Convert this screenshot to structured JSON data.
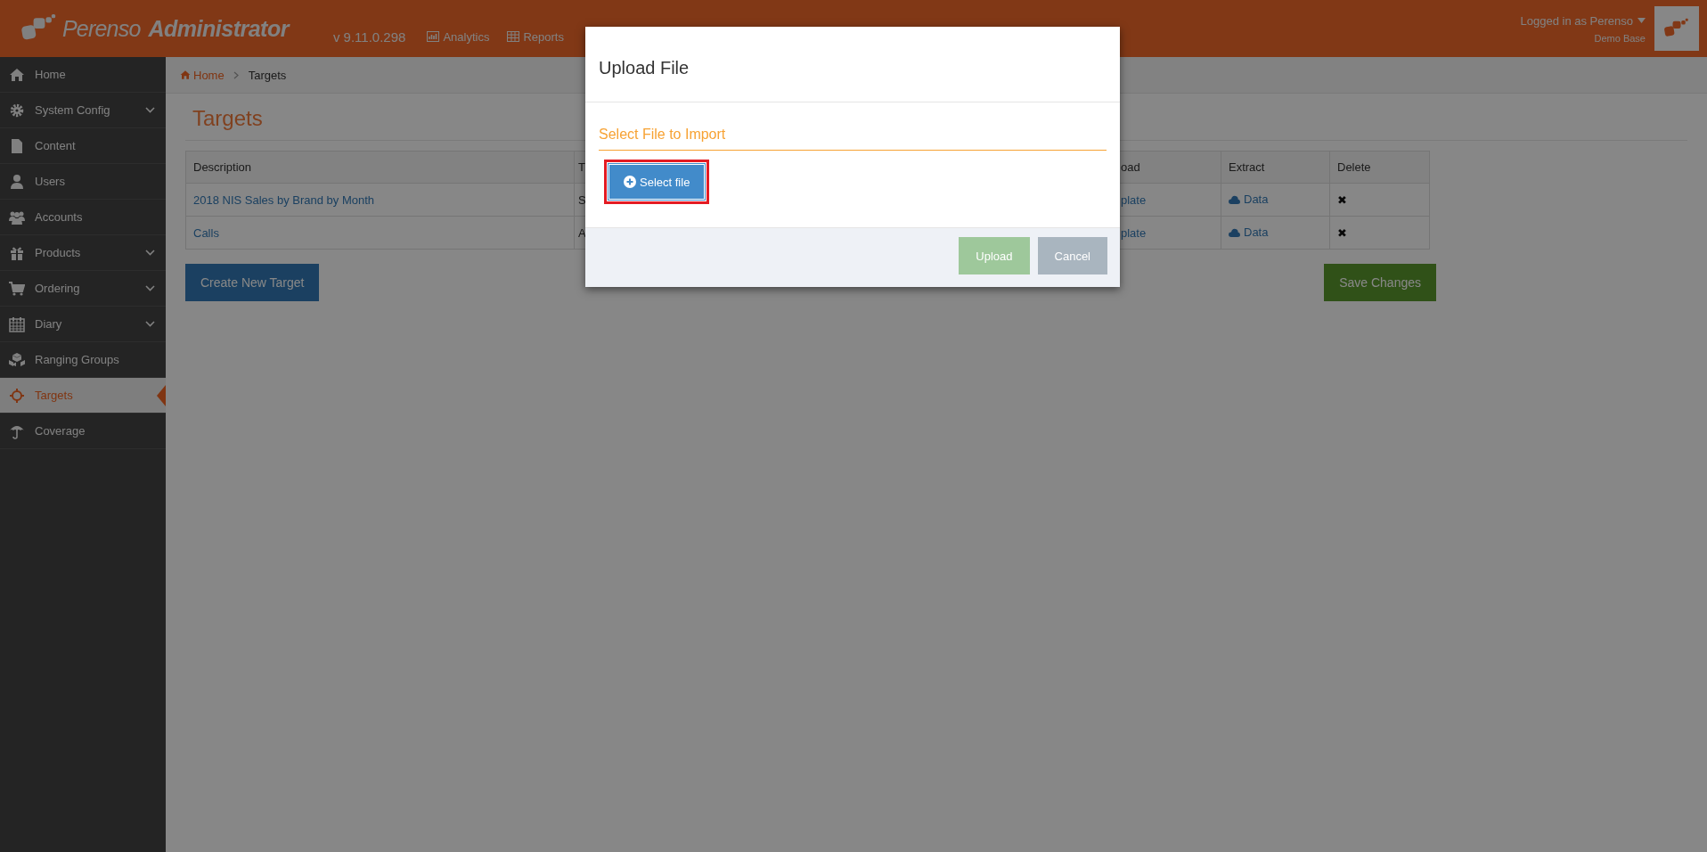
{
  "header": {
    "logo_light": "Perenso",
    "logo_bold": "Administrator",
    "version": "v 9.11.0.298",
    "nav": [
      {
        "label": "Analytics"
      },
      {
        "label": "Reports"
      }
    ],
    "user": "Logged in as Perenso",
    "account": "Demo Base"
  },
  "sidebar": {
    "items": [
      {
        "label": "Home",
        "has_submenu": false,
        "selected": false
      },
      {
        "label": "System Config",
        "has_submenu": true,
        "selected": false
      },
      {
        "label": "Content",
        "has_submenu": false,
        "selected": false
      },
      {
        "label": "Users",
        "has_submenu": false,
        "selected": false
      },
      {
        "label": "Accounts",
        "has_submenu": false,
        "selected": false
      },
      {
        "label": "Products",
        "has_submenu": true,
        "selected": false
      },
      {
        "label": "Ordering",
        "has_submenu": true,
        "selected": false
      },
      {
        "label": "Diary",
        "has_submenu": true,
        "selected": false
      },
      {
        "label": "Ranging Groups",
        "has_submenu": false,
        "selected": false
      },
      {
        "label": "Targets",
        "has_submenu": false,
        "selected": true
      },
      {
        "label": "Coverage",
        "has_submenu": false,
        "selected": false
      }
    ]
  },
  "breadcrumb": [
    {
      "label": "Home",
      "link": true
    },
    {
      "label": "Targets",
      "link": false
    }
  ],
  "page_title": "Targets",
  "table": {
    "columns": [
      "Description",
      "T",
      "oad",
      "Extract",
      "Delete"
    ],
    "rows": [
      {
        "description": "2018 NIS Sales by Brand by Month",
        "column_2": "S",
        "column_3": "plate",
        "extract": "Data",
        "delete": "✖"
      },
      {
        "description": "Calls",
        "column_2": "A",
        "column_3": "plate",
        "extract": "Data",
        "delete": "✖"
      }
    ]
  },
  "create_button": "Create New Target",
  "save_button": "Save Changes",
  "modal": {
    "title": "Upload File",
    "section_label": "Select File to Import",
    "select_button": "Select file",
    "highlighted": true,
    "upload_button": {
      "label": "Upload",
      "disabled": true
    },
    "cancel_button": "Cancel"
  }
}
